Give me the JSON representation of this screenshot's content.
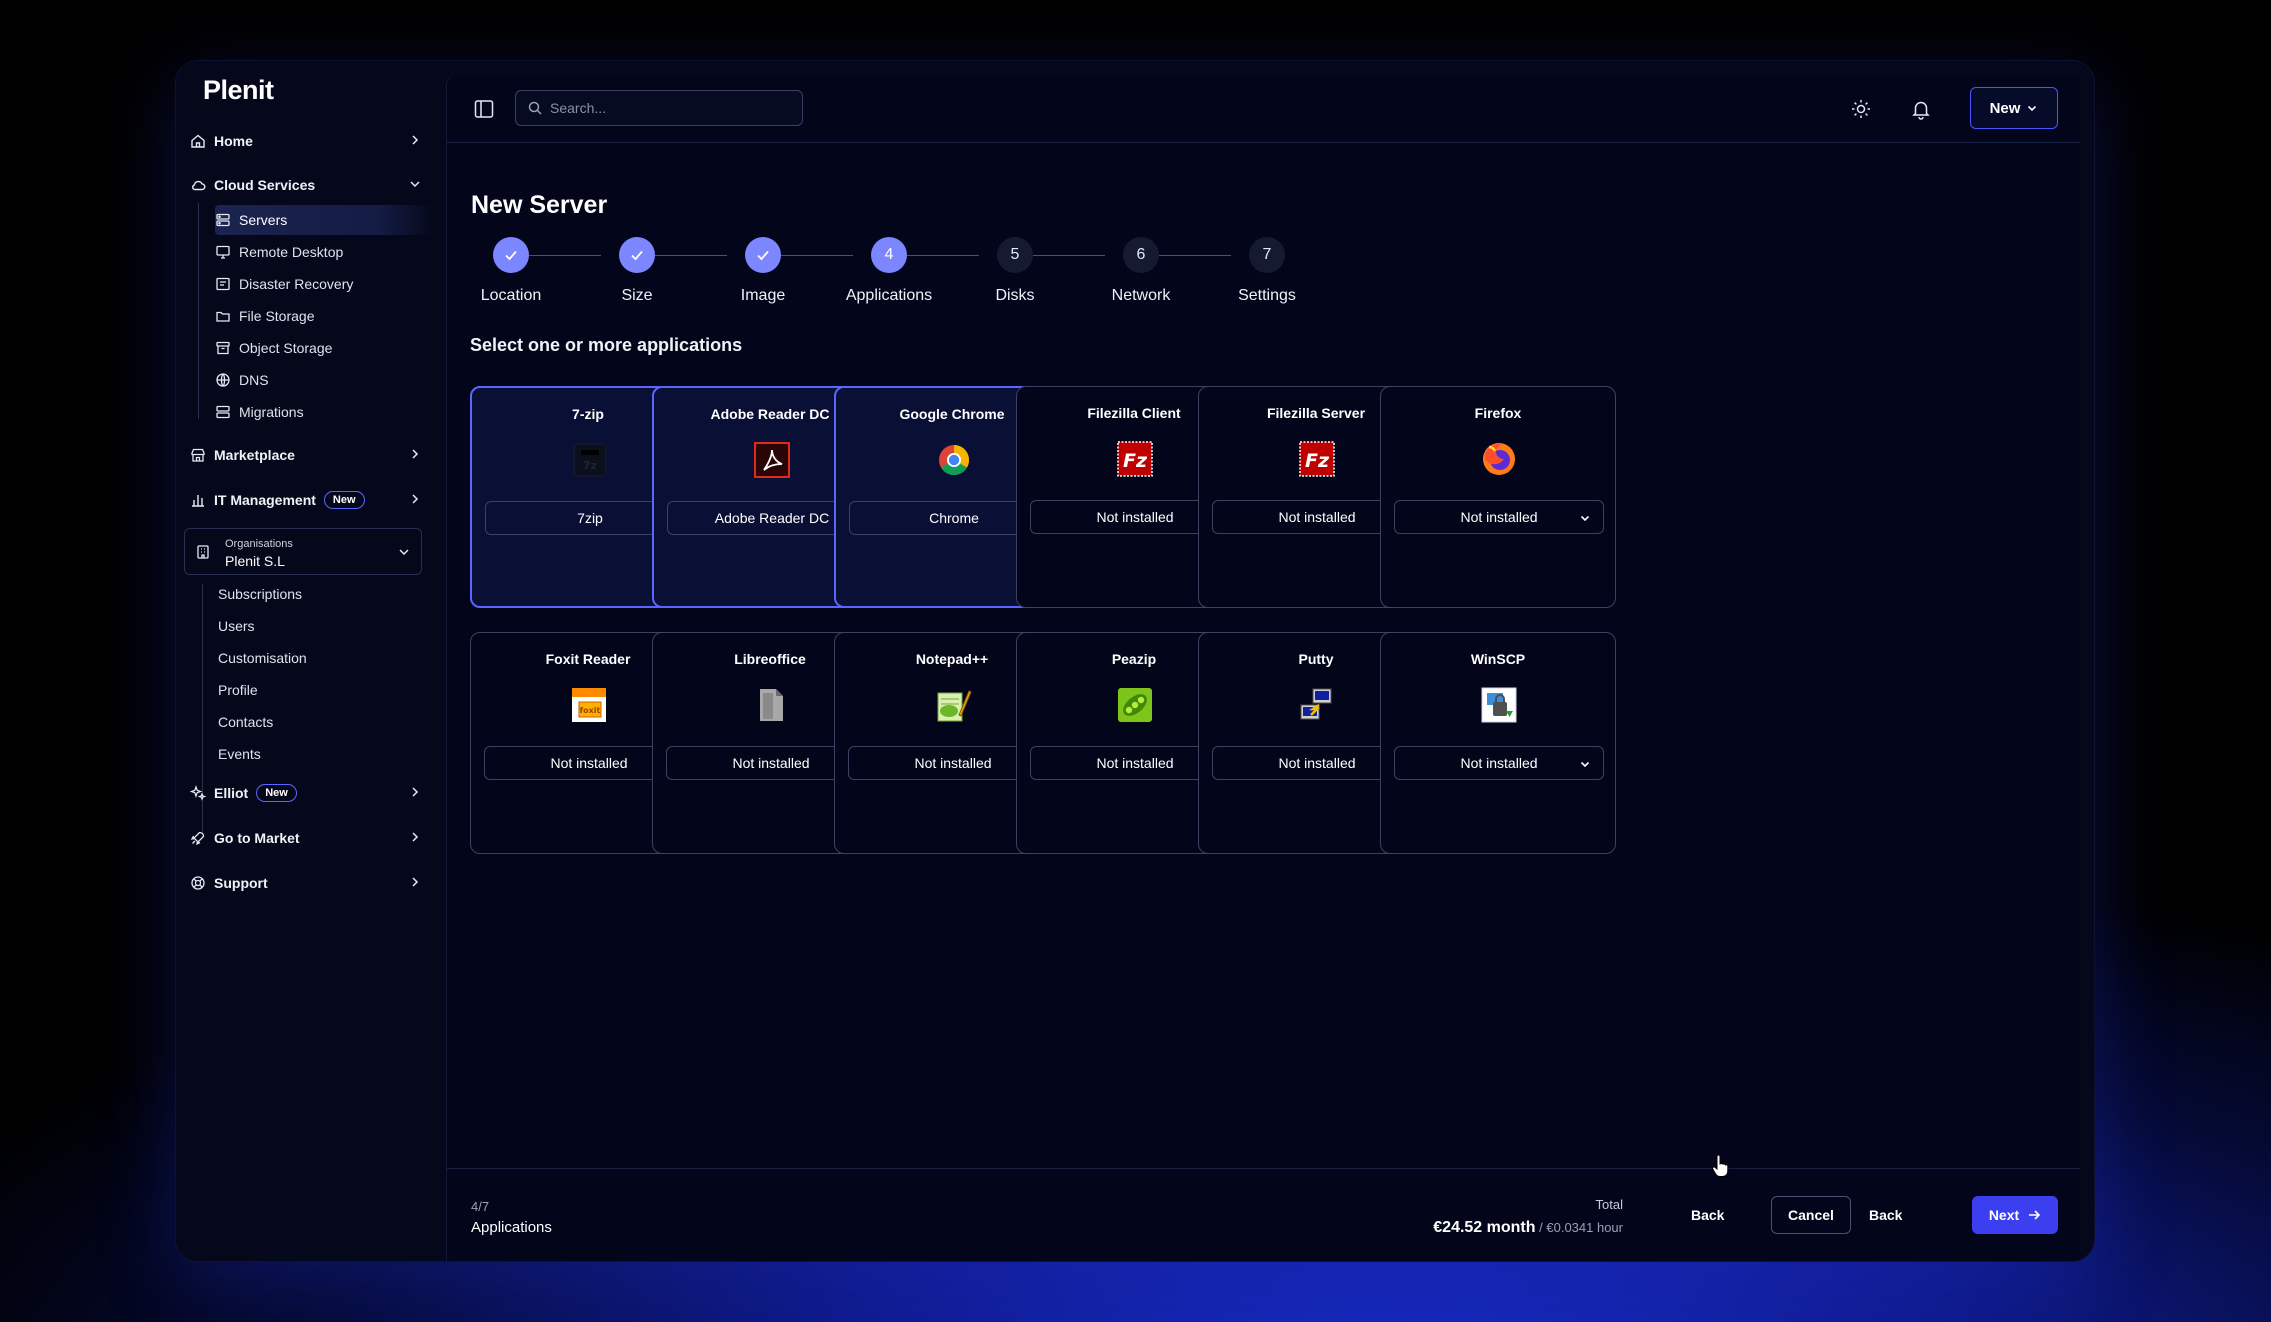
{
  "brand": "Plenit",
  "sidebar": {
    "home": "Home",
    "cloud_services": "Cloud Services",
    "cloud_items": [
      "Servers",
      "Remote Desktop",
      "Disaster Recovery",
      "File Storage",
      "Object Storage",
      "DNS",
      "Migrations"
    ],
    "marketplace": "Marketplace",
    "it_management": "IT Management",
    "new_badge": "New",
    "org_label": "Organisations",
    "org_name": "Plenit S.L",
    "org_items": [
      "Subscriptions",
      "Users",
      "Customisation",
      "Profile",
      "Contacts",
      "Events"
    ],
    "elliot": "Elliot",
    "go_to_market": "Go to Market",
    "support": "Support"
  },
  "topbar": {
    "search_placeholder": "Search...",
    "new_button": "New"
  },
  "page": {
    "title": "New Server",
    "section_title": "Select one or more applications"
  },
  "steps": [
    {
      "label": "Location",
      "number": "1",
      "state": "done"
    },
    {
      "label": "Size",
      "number": "2",
      "state": "done"
    },
    {
      "label": "Image",
      "number": "3",
      "state": "done"
    },
    {
      "label": "Applications",
      "number": "4",
      "state": "current"
    },
    {
      "label": "Disks",
      "number": "5",
      "state": "todo"
    },
    {
      "label": "Network",
      "number": "6",
      "state": "todo"
    },
    {
      "label": "Settings",
      "number": "7",
      "state": "todo"
    }
  ],
  "apps": [
    {
      "name": "7-zip",
      "value": "7zip",
      "selected": true,
      "icon": "7zip-icon"
    },
    {
      "name": "Adobe Reader DC",
      "value": "Adobe Reader DC",
      "selected": true,
      "icon": "adobe-reader-icon"
    },
    {
      "name": "Google Chrome",
      "value": "Chrome",
      "selected": true,
      "icon": "chrome-icon"
    },
    {
      "name": "Filezilla Client",
      "value": "Not installed",
      "selected": false,
      "icon": "filezilla-client-icon"
    },
    {
      "name": "Filezilla Server",
      "value": "Not installed",
      "selected": false,
      "icon": "filezilla-server-icon"
    },
    {
      "name": "Firefox",
      "value": "Not installed",
      "selected": false,
      "icon": "firefox-icon"
    },
    {
      "name": "Foxit Reader",
      "value": "Not installed",
      "selected": false,
      "icon": "foxit-reader-icon"
    },
    {
      "name": "Libreoffice",
      "value": "Not installed",
      "selected": false,
      "icon": "libreoffice-icon"
    },
    {
      "name": "Notepad++",
      "value": "Not installed",
      "selected": false,
      "icon": "notepadpp-icon"
    },
    {
      "name": "Peazip",
      "value": "Not installed",
      "selected": false,
      "icon": "peazip-icon"
    },
    {
      "name": "Putty",
      "value": "Not installed",
      "selected": false,
      "icon": "putty-icon"
    },
    {
      "name": "WinSCP",
      "value": "Not installed",
      "selected": false,
      "icon": "winscp-icon"
    }
  ],
  "footer": {
    "step_count": "4/7",
    "step_name": "Applications",
    "total_label": "Total",
    "price_month": "€24.52 month",
    "price_hour": " / €0.0341 hour",
    "back": "Back",
    "cancel": "Cancel",
    "next": "Next"
  },
  "colors": {
    "accent": "#5a66ff",
    "primary_button": "#3b3ff0",
    "step_done": "#7b86ff"
  }
}
